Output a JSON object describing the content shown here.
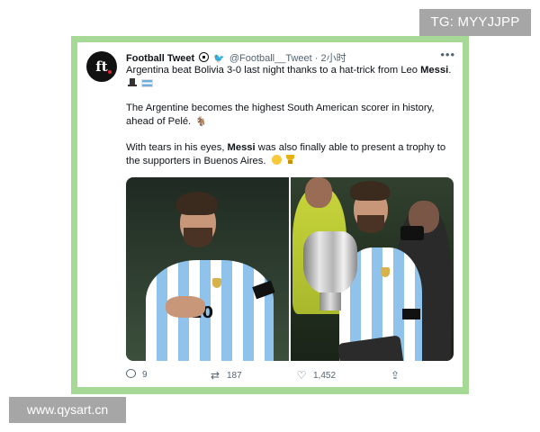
{
  "watermarks": {
    "top_right": "TG: MYYJJPP",
    "bottom_left": "www.qysart.cn"
  },
  "tweet": {
    "avatar_text": "ft",
    "author_name": "Football Tweet",
    "author_icons": [
      "soccer-ball-icon",
      "twitter-bird-icon"
    ],
    "handle": "@Football__Tweet",
    "separator": "·",
    "time": "2小时",
    "paragraph1_before": "Argentina beat Bolivia 3-0 last night thanks to a hat-trick from Leo ",
    "paragraph1_bold": "Messi",
    "paragraph1_after": ".",
    "paragraph2": "The Argentine becomes the highest South American scorer in history, ahead of Pelé.",
    "paragraph3_before": "With tears in his eyes, ",
    "paragraph3_bold": "Messi",
    "paragraph3_after": " was also finally able to present a trophy to the supporters in Buenos Aires.",
    "actions": {
      "reply_count": "9",
      "retweet_count": "187",
      "like_count": "1,452"
    }
  },
  "colors": {
    "frame_green": "#a5d995",
    "watermark_gray": "#a6a6a6",
    "twitter_blue": "#1d9bf0",
    "secondary_text": "#536471"
  }
}
